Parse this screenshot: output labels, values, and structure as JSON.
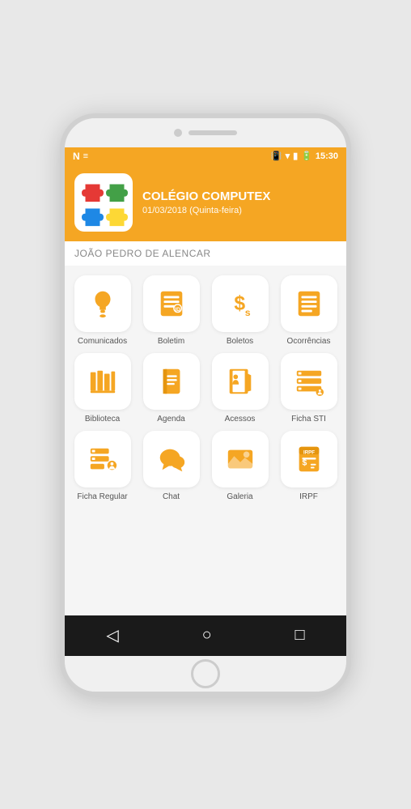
{
  "status_bar": {
    "left_icons": [
      "N",
      "≡"
    ],
    "right_text": "15:30"
  },
  "header": {
    "title": "COLÉGIO COMPUTEX",
    "date": "01/03/2018 (Quinta-feira)",
    "user": "JOÃO PEDRO DE ALENCAR"
  },
  "grid": {
    "rows": [
      [
        {
          "label": "Comunicados",
          "icon": "bell"
        },
        {
          "label": "Boletim",
          "icon": "id-card"
        },
        {
          "label": "Boletos",
          "icon": "dollar"
        },
        {
          "label": "Ocorrências",
          "icon": "list"
        }
      ],
      [
        {
          "label": "Biblioteca",
          "icon": "books"
        },
        {
          "label": "Agenda",
          "icon": "notebook"
        },
        {
          "label": "Acessos",
          "icon": "door"
        },
        {
          "label": "Ficha STI",
          "icon": "server"
        }
      ],
      [
        {
          "label": "Ficha Regular",
          "icon": "person-list"
        },
        {
          "label": "Chat",
          "icon": "chat"
        },
        {
          "label": "Galeria",
          "icon": "gallery"
        },
        {
          "label": "IRPF",
          "icon": "irpf"
        }
      ]
    ]
  },
  "bottom_nav": {
    "back_label": "◁",
    "home_label": "○",
    "recent_label": "□"
  }
}
